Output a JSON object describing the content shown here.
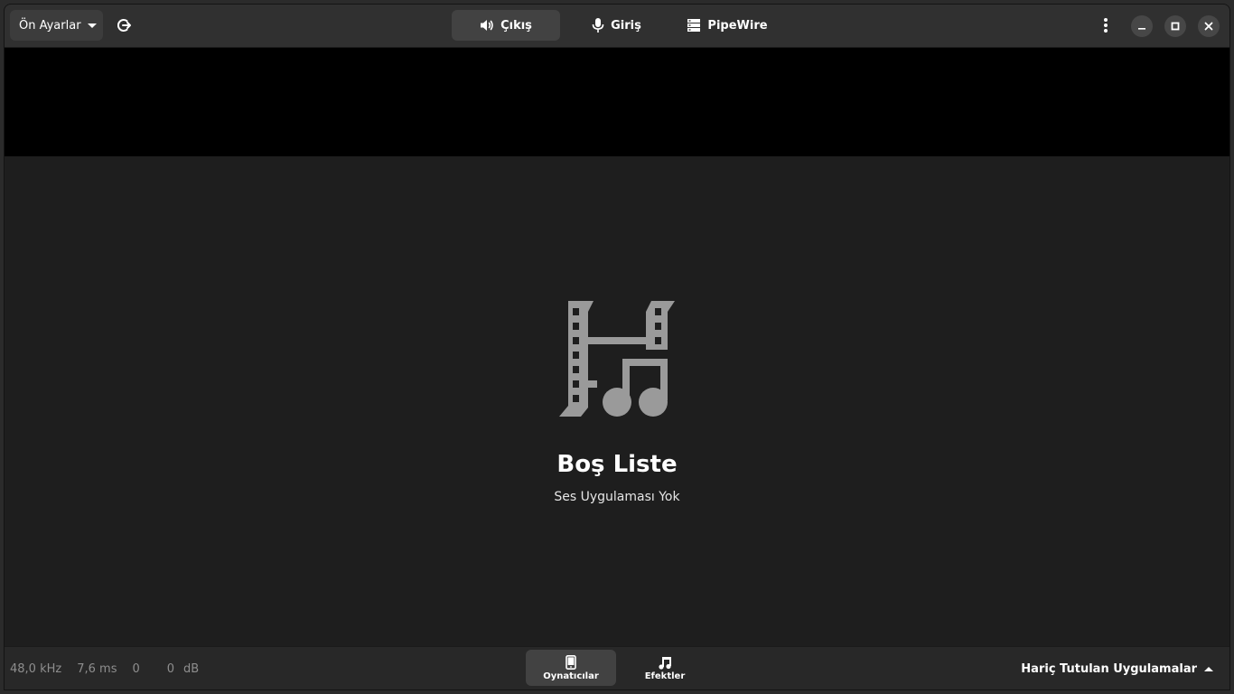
{
  "header": {
    "presets_label": "Ön Ayarlar",
    "tabs": [
      {
        "label": "Çıkış",
        "icon": "speaker-icon",
        "active": true
      },
      {
        "label": "Giriş",
        "icon": "microphone-icon",
        "active": false
      },
      {
        "label": "PipeWire",
        "icon": "server-icon",
        "active": false
      }
    ]
  },
  "empty_state": {
    "icon": "film-music-icon",
    "title": "Boş Liste",
    "subtitle": "Ses Uygulaması Yok"
  },
  "status": {
    "sample_rate": "48,0 kHz",
    "latency": "7,6 ms",
    "value_a": "0",
    "value_b": "0",
    "unit": "dB"
  },
  "view_switcher": [
    {
      "label": "Oynatıcılar",
      "icon": "phone-icon",
      "active": true
    },
    {
      "label": "Efektler",
      "icon": "music-note-icon",
      "active": false
    }
  ],
  "excluded_apps_label": "Hariç Tutulan Uygulamalar",
  "colors": {
    "window_bg": "#1e1e1e",
    "header_bg": "#303030",
    "active_bg": "#424242",
    "icon_gray": "#9a9a9a"
  }
}
